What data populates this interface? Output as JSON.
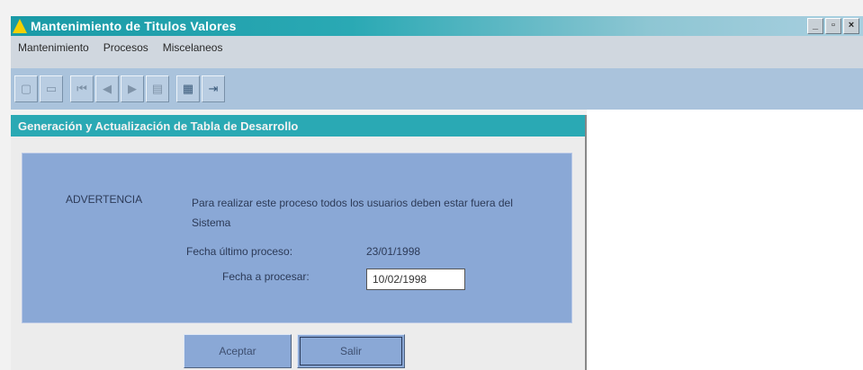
{
  "window": {
    "title": "Mantenimiento de Titulos Valores",
    "controls": [
      "_",
      "▫",
      "×"
    ]
  },
  "menu": {
    "items": [
      {
        "label": "Mantenimiento"
      },
      {
        "label": "Procesos"
      },
      {
        "label": "Miscelaneos"
      }
    ]
  },
  "toolbar": {
    "buttons": [
      {
        "icon": "new-icon",
        "glyph": "▢"
      },
      {
        "icon": "open-icon",
        "glyph": "▭"
      },
      {
        "icon": "first-icon",
        "glyph": "⏮"
      },
      {
        "icon": "prev-icon",
        "glyph": "◀"
      },
      {
        "icon": "next-icon",
        "glyph": "▶"
      },
      {
        "icon": "save-icon",
        "glyph": "▤"
      },
      {
        "icon": "print-icon",
        "glyph": "▦"
      },
      {
        "icon": "exit-icon",
        "glyph": "⇥"
      }
    ]
  },
  "dialog": {
    "title": "Generación y Actualización de Tabla de Desarrollo",
    "warning_label": "ADVERTENCIA",
    "warning_text": "Para realizar este proceso todos los usuarios deben estar fuera del Sistema",
    "last_process_label": "Fecha último proceso:",
    "last_process_value": "23/01/1998",
    "process_date_label": "Fecha a procesar:",
    "process_date_value": "10/02/1998",
    "accept_label": "Aceptar",
    "exit_label": "Salir"
  }
}
